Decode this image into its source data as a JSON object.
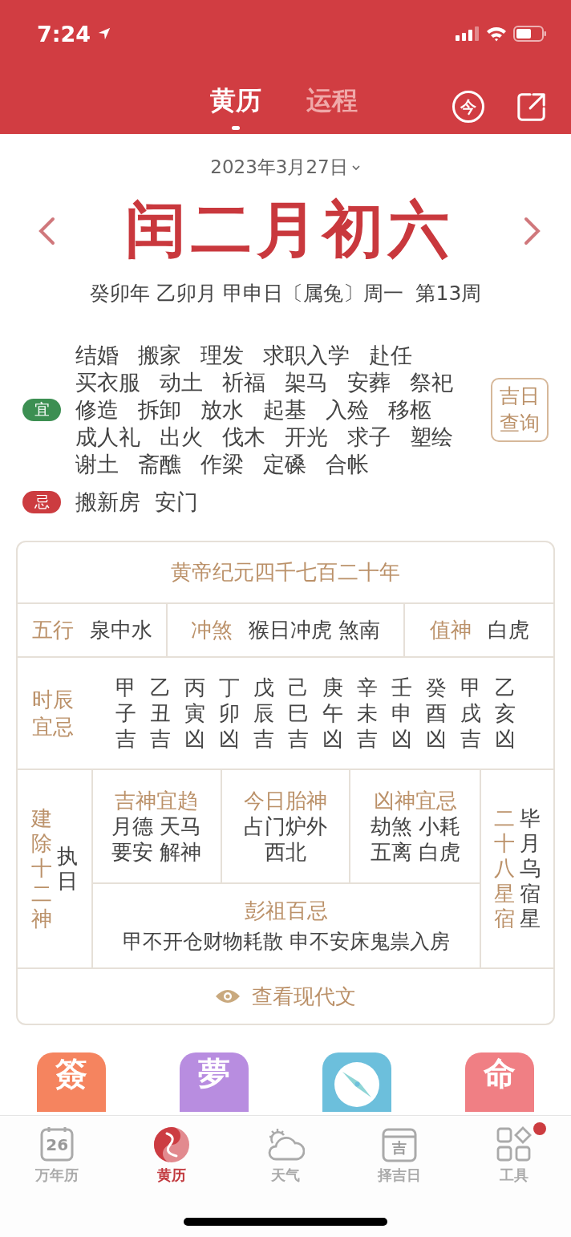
{
  "status_bar": {
    "time": "7:24"
  },
  "tabs": [
    {
      "label": "黄历",
      "selected": true
    },
    {
      "label": "运程",
      "selected": false
    }
  ],
  "today_button": {
    "label": "今"
  },
  "date_picker": {
    "label": "2023年3月27日"
  },
  "lunar_date": "闰二月初六",
  "ganzhi": "癸卯年 乙卯月 甲申日〔属兔〕周一  第13周",
  "yi": {
    "badge": "宜",
    "rows": [
      [
        "结婚",
        "搬家",
        "理发",
        "求职入学",
        "赴任"
      ],
      [
        "买衣服",
        "动土",
        "祈福",
        "架马",
        "安葬",
        "祭祀"
      ],
      [
        "修造",
        "拆卸",
        "放水",
        "起基",
        "入殓",
        "移柩"
      ],
      [
        "成人礼",
        "出火",
        "伐木",
        "开光",
        "求子",
        "塑绘"
      ],
      [
        "谢土",
        "斋醮",
        "作梁",
        "定磉",
        "合帐"
      ]
    ]
  },
  "ji": {
    "badge": "忌",
    "items": [
      "搬新房",
      "安门"
    ]
  },
  "lucky_day_button": "吉日查询",
  "almanac": {
    "era": "黄帝纪元四千七百二十年",
    "facts": [
      {
        "label": "五行",
        "value": "泉中水"
      },
      {
        "label": "冲煞",
        "value": "猴日冲虎 煞南"
      },
      {
        "label": "值神",
        "value": "白虎"
      }
    ],
    "hours_label": "时辰宜忌",
    "hours": [
      {
        "stem": "甲",
        "branch": "子",
        "luck": "吉"
      },
      {
        "stem": "乙",
        "branch": "丑",
        "luck": "吉"
      },
      {
        "stem": "丙",
        "branch": "寅",
        "luck": "凶"
      },
      {
        "stem": "丁",
        "branch": "卯",
        "luck": "凶"
      },
      {
        "stem": "戊",
        "branch": "辰",
        "luck": "吉"
      },
      {
        "stem": "己",
        "branch": "巳",
        "luck": "吉"
      },
      {
        "stem": "庚",
        "branch": "午",
        "luck": "凶"
      },
      {
        "stem": "辛",
        "branch": "未",
        "luck": "吉"
      },
      {
        "stem": "壬",
        "branch": "申",
        "luck": "凶"
      },
      {
        "stem": "癸",
        "branch": "酉",
        "luck": "凶"
      },
      {
        "stem": "甲",
        "branch": "戌",
        "luck": "吉"
      },
      {
        "stem": "乙",
        "branch": "亥",
        "luck": "凶"
      }
    ],
    "twelve_gods": {
      "label": "建除十二神",
      "value": "执日"
    },
    "gods": [
      {
        "title": "吉神宜趋",
        "lines": [
          "月德 天马",
          "要安 解神"
        ]
      },
      {
        "title": "今日胎神",
        "lines": [
          "占门炉外",
          "西北"
        ]
      },
      {
        "title": "凶神宜忌",
        "lines": [
          "劫煞 小耗",
          "五离 白虎"
        ]
      }
    ],
    "pengzu": {
      "title": "彭祖百忌",
      "text": "甲不开仓财物耗散 申不安床鬼祟入房"
    },
    "mansion": {
      "label": "二十八星宿",
      "value": "毕月乌宿星"
    },
    "modern_text_button": "查看现代文"
  },
  "apps": [
    {
      "glyph": "簽",
      "color": "#f5845f"
    },
    {
      "glyph": "夢",
      "color": "#b88de0"
    },
    {
      "kind": "compass",
      "color": "#6cbfdc"
    },
    {
      "glyph": "命",
      "color": "#f07f84"
    }
  ],
  "bottom_tabs": [
    {
      "label": "万年历",
      "selected": false,
      "kind": "calendar"
    },
    {
      "label": "黄历",
      "selected": true,
      "kind": "yinyang"
    },
    {
      "label": "天气",
      "selected": false,
      "kind": "weather"
    },
    {
      "label": "择吉日",
      "selected": false,
      "kind": "pick"
    },
    {
      "label": "工具",
      "selected": false,
      "kind": "tools",
      "badge": true
    }
  ],
  "calendar_icon_day": "26",
  "pick_icon_glyph": "吉"
}
